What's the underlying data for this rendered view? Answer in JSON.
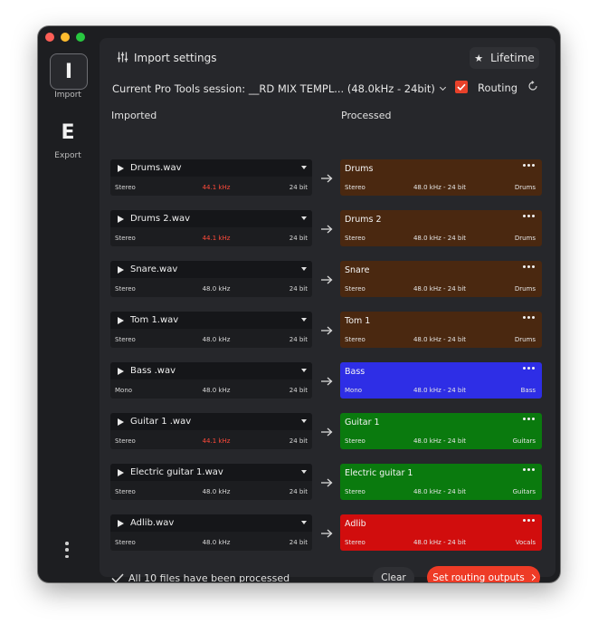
{
  "sidebar": {
    "import": {
      "letter": "I",
      "label": "Import"
    },
    "export": {
      "letter": "E",
      "label": "Export"
    },
    "more_icon": "vertical-ellipsis-icon"
  },
  "header": {
    "title": "Import settings",
    "settings_icon": "sliders-icon",
    "lifetime_label": "Lifetime",
    "lifetime_icon": "star-icon"
  },
  "session": {
    "label": "Current Pro Tools session: __RD MIX TEMPL... (48.0kHz - 24bit)",
    "routing_label": "Routing",
    "routing_checked": true
  },
  "columns": {
    "imported": "Imported",
    "processed": "Processed"
  },
  "rows": [
    {
      "imported": {
        "name": "Drums.wav",
        "channels": "Stereo",
        "rate": "44.1 kHz",
        "rate_mismatch": true,
        "bits": "24 bit"
      },
      "processed": {
        "name": "Drums",
        "channels": "Stereo",
        "format": "48.0 kHz - 24 bit",
        "dest": "Drums",
        "color": "#4a2810"
      }
    },
    {
      "imported": {
        "name": "Drums 2.wav",
        "channels": "Stereo",
        "rate": "44.1 kHz",
        "rate_mismatch": true,
        "bits": "24 bit"
      },
      "processed": {
        "name": "Drums 2",
        "channels": "Stereo",
        "format": "48.0 kHz - 24 bit",
        "dest": "Drums",
        "color": "#4a2810"
      }
    },
    {
      "imported": {
        "name": "Snare.wav",
        "channels": "Stereo",
        "rate": "48.0 kHz",
        "rate_mismatch": false,
        "bits": "24 bit"
      },
      "processed": {
        "name": "Snare",
        "channels": "Stereo",
        "format": "48.0 kHz - 24 bit",
        "dest": "Drums",
        "color": "#4a2810"
      }
    },
    {
      "imported": {
        "name": "Tom 1.wav",
        "channels": "Stereo",
        "rate": "48.0 kHz",
        "rate_mismatch": false,
        "bits": "24 bit"
      },
      "processed": {
        "name": "Tom 1",
        "channels": "Stereo",
        "format": "48.0 kHz - 24 bit",
        "dest": "Drums",
        "color": "#4a2810"
      }
    },
    {
      "imported": {
        "name": "Bass .wav",
        "channels": "Mono",
        "rate": "48.0 kHz",
        "rate_mismatch": false,
        "bits": "24 bit"
      },
      "processed": {
        "name": "Bass",
        "channels": "Mono",
        "format": "48.0 kHz - 24 bit",
        "dest": "Bass",
        "color": "#2e2ee6"
      }
    },
    {
      "imported": {
        "name": "Guitar 1 .wav",
        "channels": "Stereo",
        "rate": "44.1 kHz",
        "rate_mismatch": true,
        "bits": "24 bit"
      },
      "processed": {
        "name": "Guitar 1",
        "channels": "Stereo",
        "format": "48.0 kHz - 24 bit",
        "dest": "Guitars",
        "color": "#0a7a0e"
      }
    },
    {
      "imported": {
        "name": "Electric guitar 1.wav",
        "channels": "Stereo",
        "rate": "48.0 kHz",
        "rate_mismatch": false,
        "bits": "24 bit"
      },
      "processed": {
        "name": "Electric guitar 1",
        "channels": "Stereo",
        "format": "48.0 kHz - 24 bit",
        "dest": "Guitars",
        "color": "#0a7a0e"
      }
    },
    {
      "imported": {
        "name": "Adlib.wav",
        "channels": "Stereo",
        "rate": "48.0 kHz",
        "rate_mismatch": false,
        "bits": "24 bit"
      },
      "processed": {
        "name": "Adlib",
        "channels": "Stereo",
        "format": "48.0 kHz - 24 bit",
        "dest": "Vocals",
        "color": "#d10d0d"
      }
    }
  ],
  "footer": {
    "status": "All 10 files have been processed",
    "clear_label": "Clear",
    "primary_label": "Set routing outputs"
  }
}
